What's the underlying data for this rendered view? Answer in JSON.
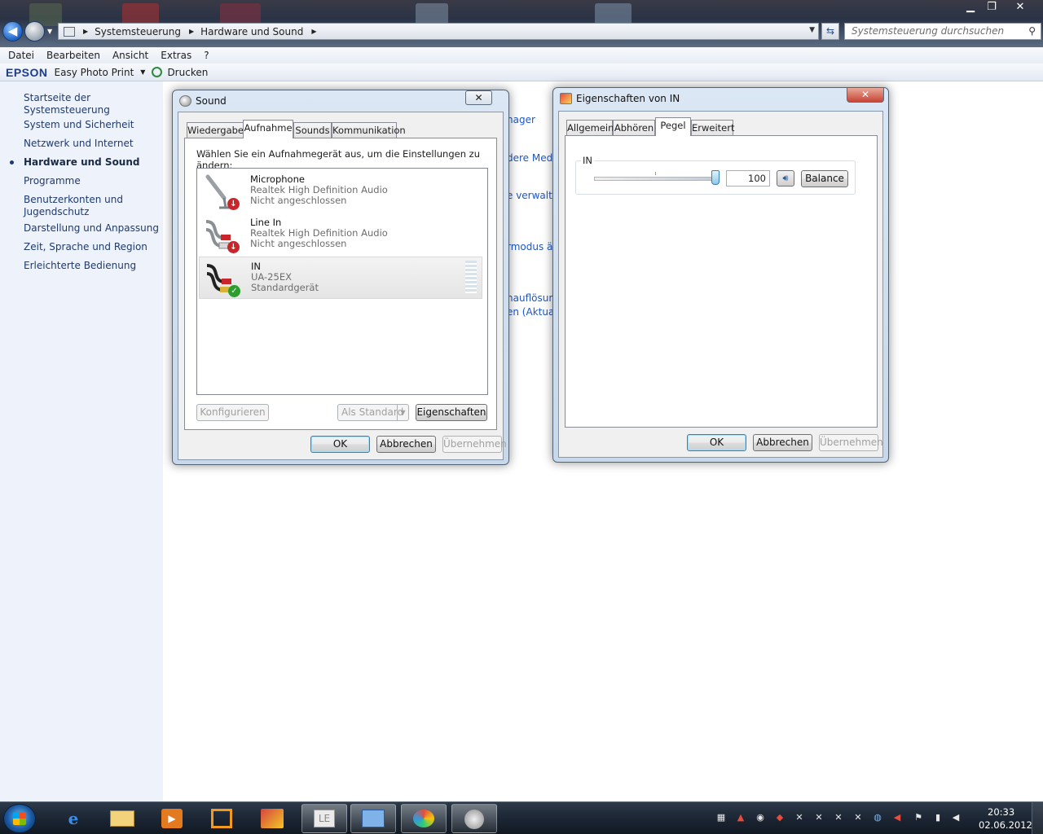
{
  "window": {
    "controls": {
      "minimize": "▁",
      "restore": "❐",
      "close": "✕"
    }
  },
  "address": {
    "breadcrumbs": [
      "Systemsteuerung",
      "Hardware und Sound"
    ],
    "search_placeholder": "Systemsteuerung durchsuchen"
  },
  "menubar": [
    "Datei",
    "Bearbeiten",
    "Ansicht",
    "Extras",
    "?"
  ],
  "toolbar": {
    "brand": "EPSON",
    "easy_print": "Easy Photo Print",
    "print": "Drucken"
  },
  "leftnav": {
    "home": "Startseite der Systemsteuerung",
    "items": [
      "System und Sicherheit",
      "Netzwerk und Internet",
      "Hardware und Sound",
      "Programme",
      "Benutzerkonten und Jugendschutz",
      "Darstellung und Anpassung",
      "Zeit, Sprache und Region",
      "Erleichterte Bedienung"
    ],
    "active_index": 2
  },
  "background_links": [
    "nager",
    "dere Medi",
    "e verwalter",
    "rmodus är",
    "nauflösung",
    "en (Aktua"
  ],
  "sound_dialog": {
    "title": "Sound",
    "close": "✕",
    "tabs": [
      "Wiedergabe",
      "Aufnahme",
      "Sounds",
      "Kommunikation"
    ],
    "selected_tab": 1,
    "instruction": "Wählen Sie ein Aufnahmegerät aus, um die Einstellungen zu ändern:",
    "devices": [
      {
        "name": "Microphone",
        "driver": "Realtek High Definition Audio",
        "status": "Nicht angeschlossen",
        "icon": "microphone-icon",
        "badge": "disconnected"
      },
      {
        "name": "Line In",
        "driver": "Realtek High Definition Audio",
        "status": "Nicht angeschlossen",
        "icon": "line-in-cable-icon",
        "badge": "disconnected"
      },
      {
        "name": "IN",
        "driver": "UA-25EX",
        "status": "Standardgerät",
        "icon": "rca-cable-icon",
        "badge": "default",
        "selected": true
      }
    ],
    "buttons": {
      "configure": "Konfigurieren",
      "set_default": "Als Standard",
      "properties": "Eigenschaften",
      "ok": "OK",
      "cancel": "Abbrechen",
      "apply": "Übernehmen"
    }
  },
  "props_dialog": {
    "title": "Eigenschaften von IN",
    "close": "✕",
    "tabs": [
      "Allgemein",
      "Abhören",
      "Pegel",
      "Erweitert"
    ],
    "selected_tab": 2,
    "level": {
      "label": "IN",
      "value": "100",
      "level_percent": 100,
      "mute_icon": "speaker-icon",
      "balance": "Balance"
    },
    "buttons": {
      "ok": "OK",
      "cancel": "Abbrechen",
      "apply": "Übernehmen"
    }
  },
  "taskbar": {
    "apps": [
      "windows-explorer",
      "internet-explorer",
      "file-explorer",
      "media-player",
      "app-orange",
      "app-install",
      "app-le",
      "app-control-panel",
      "app-paint",
      "app-sound"
    ],
    "clock": {
      "time": "20:33",
      "date": "02.06.2012"
    }
  },
  "colors": {
    "link": "#1e3a6e",
    "nav_bg": "#eef3fb",
    "taskbar": "#1c2634",
    "default_badge": "#2e9c2e",
    "disconnected_badge": "#c9262c"
  }
}
